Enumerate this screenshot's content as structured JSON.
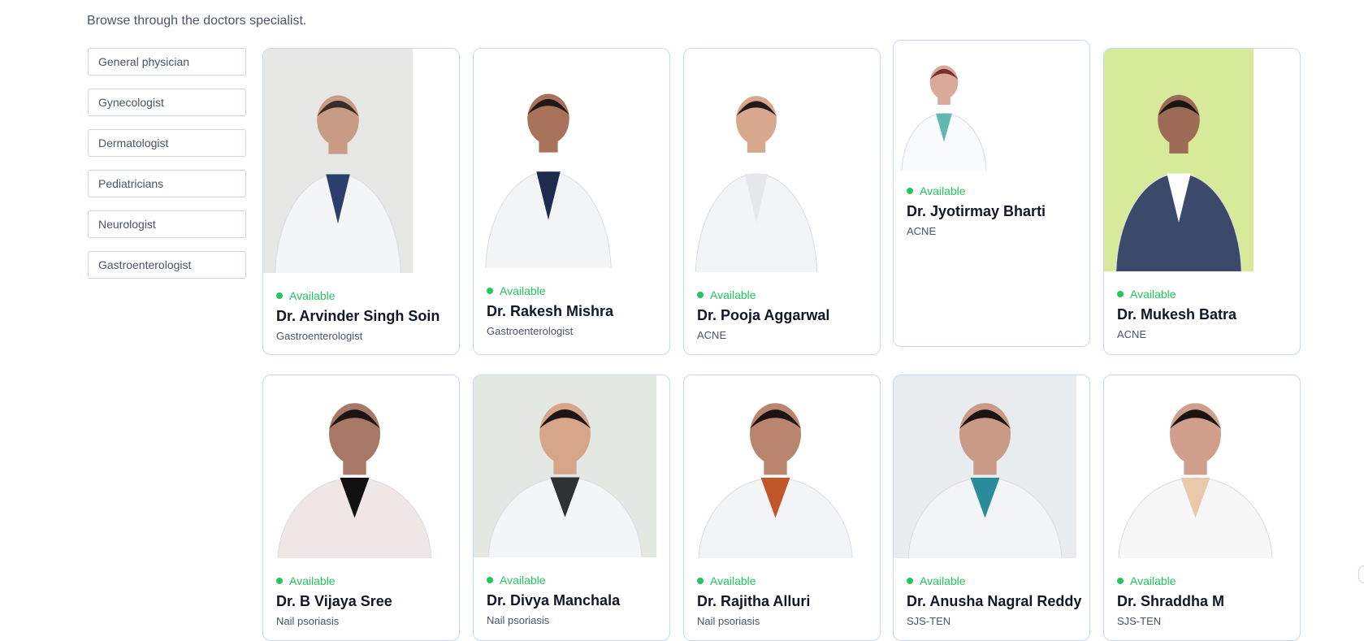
{
  "page": {
    "intro": "Browse through the doctors specialist."
  },
  "filters": [
    {
      "label": "General physician"
    },
    {
      "label": "Gynecologist"
    },
    {
      "label": "Dermatologist"
    },
    {
      "label": "Pediatricians"
    },
    {
      "label": "Neurologist"
    },
    {
      "label": "Gastroenterologist"
    }
  ],
  "doctors": [
    {
      "status": "Available",
      "name": "Dr. Arvinder Singh Soin",
      "speciality": "Gastroenterologist",
      "photo_bg": "#e7e7e5",
      "coat": "#f4f5f7",
      "skin": "#c79b84",
      "hair": "#3a2d27",
      "accent": "#2c3e6b"
    },
    {
      "status": "Available",
      "name": "Dr. Rakesh Mishra",
      "speciality": "Gastroenterologist",
      "photo_bg": "#ffffff",
      "coat": "#f3f4f6",
      "skin": "#a8735a",
      "hair": "#1f1a18",
      "accent": "#1d2b4f"
    },
    {
      "status": "Available",
      "name": "Dr. Pooja Aggarwal",
      "speciality": "ACNE",
      "photo_bg": "#ffffff",
      "coat": "#f3f4f6",
      "skin": "#d7a78e",
      "hair": "#231a17",
      "accent": "#e5e7eb"
    },
    {
      "status": "Available",
      "name": "Dr. Jyotirmay Bharti",
      "speciality": "ACNE",
      "photo_bg": "#ffffff",
      "coat": "#f8fafc",
      "skin": "#d9a99a",
      "hair": "#7a2e2e",
      "accent": "#5fb8b2"
    },
    {
      "status": "Available",
      "name": "Dr. Mukesh Batra",
      "speciality": "ACNE",
      "photo_bg": "#d7ea9a",
      "coat": "#3b4a6b",
      "skin": "#9c6a55",
      "hair": "#1b1512",
      "accent": "#ffffff"
    },
    {
      "status": "Available",
      "name": "Dr. B Vijaya Sree",
      "speciality": "Nail psoriasis",
      "photo_bg": "#ffffff",
      "coat": "#f1e6e6",
      "skin": "#a87866",
      "hair": "#1b1412",
      "accent": "#111111"
    },
    {
      "status": "Available",
      "name": "Dr. Divya Manchala",
      "speciality": "Nail psoriasis",
      "photo_bg": "#e3e9e2",
      "coat": "#f4f5f7",
      "skin": "#d6a58a",
      "hair": "#1d1614",
      "accent": "#2e3235"
    },
    {
      "status": "Available",
      "name": "Dr. Rajitha Alluri",
      "speciality": "Nail psoriasis",
      "photo_bg": "#ffffff",
      "coat": "#f3f4f6",
      "skin": "#b9856e",
      "hair": "#1b1412",
      "accent": "#c2562b"
    },
    {
      "status": "Available",
      "name": "Dr. Anusha Nagral Reddy",
      "speciality": "SJS-TEN",
      "photo_bg": "#e9ecef",
      "coat": "#f3f4f6",
      "skin": "#c99a86",
      "hair": "#1b1412",
      "accent": "#2a8c9b"
    },
    {
      "status": "Available",
      "name": "Dr. Shraddha M",
      "speciality": "SJS-TEN",
      "photo_bg": "#ffffff",
      "coat": "#f7f7f7",
      "skin": "#cf9f8b",
      "hair": "#1b1412",
      "accent": "#e8c9a9"
    }
  ],
  "colors": {
    "available": "#22c55e",
    "card_border": "#c7d7f5"
  },
  "icons": {
    "status": "dot-icon",
    "edge": "chevron-left-icon"
  }
}
